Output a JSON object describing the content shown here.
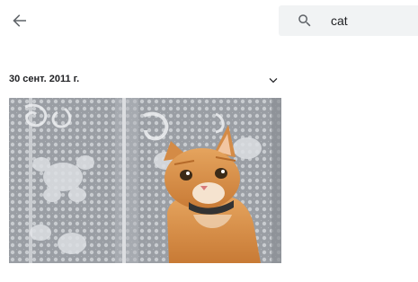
{
  "search": {
    "value": "cat"
  },
  "section": {
    "date": "30 сент. 2011 г."
  },
  "icons": {
    "back": "arrow-back-icon",
    "search": "search-icon",
    "expand": "chevron-down-icon"
  },
  "colors": {
    "search_background": "#f1f3f4",
    "icon": "#5f6368",
    "text": "#202124"
  }
}
